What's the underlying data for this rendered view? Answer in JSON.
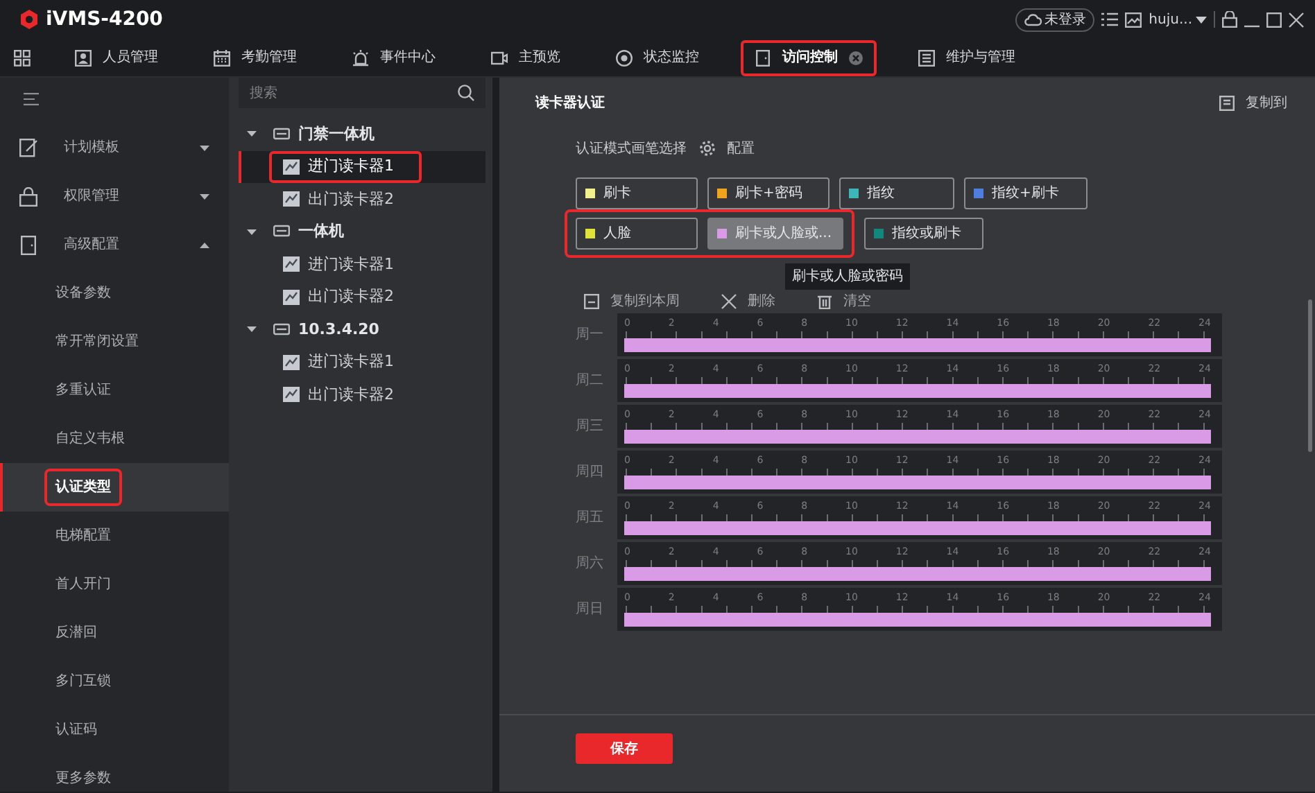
{
  "app": {
    "title": "iVMS-4200",
    "login_status": "未登录",
    "user": "huju..."
  },
  "nav_tabs": [
    {
      "label": "人员管理",
      "kind": "people",
      "selected": false,
      "highlighted": false
    },
    {
      "label": "考勤管理",
      "kind": "calendar",
      "selected": false,
      "highlighted": false
    },
    {
      "label": "事件中心",
      "kind": "alarm",
      "selected": false,
      "highlighted": false
    },
    {
      "label": "主预览",
      "kind": "camera",
      "selected": false,
      "highlighted": false
    },
    {
      "label": "状态监控",
      "kind": "monitor",
      "selected": false,
      "highlighted": false
    },
    {
      "label": "访问控制",
      "kind": "door",
      "selected": true,
      "highlighted": true
    },
    {
      "label": "维护与管理",
      "kind": "tools",
      "selected": false,
      "highlighted": false
    }
  ],
  "sidebar": {
    "items": [
      {
        "label": "计划模板",
        "kind": "edit",
        "expanded": false
      },
      {
        "label": "权限管理",
        "kind": "lock",
        "expanded": false
      },
      {
        "label": "高级配置",
        "kind": "door",
        "expanded": true,
        "children": [
          {
            "label": "设备参数",
            "selected": false,
            "highlighted": false
          },
          {
            "label": "常开常闭设置",
            "selected": false,
            "highlighted": false
          },
          {
            "label": "多重认证",
            "selected": false,
            "highlighted": false
          },
          {
            "label": "自定义韦根",
            "selected": false,
            "highlighted": false
          },
          {
            "label": "认证类型",
            "selected": true,
            "highlighted": true
          },
          {
            "label": "电梯配置",
            "selected": false,
            "highlighted": false
          },
          {
            "label": "首人开门",
            "selected": false,
            "highlighted": false
          },
          {
            "label": "反潜回",
            "selected": false,
            "highlighted": false
          },
          {
            "label": "多门互锁",
            "selected": false,
            "highlighted": false
          },
          {
            "label": "认证码",
            "selected": false,
            "highlighted": false
          },
          {
            "label": "更多参数",
            "selected": false,
            "highlighted": false
          }
        ]
      }
    ]
  },
  "tree": {
    "search": {
      "placeholder": "搜索"
    },
    "nodes": [
      {
        "label": "门禁一体机",
        "expanded": true,
        "children": [
          {
            "label": "进门读卡器1",
            "selected": true,
            "highlighted": true
          },
          {
            "label": "出门读卡器2",
            "selected": false,
            "highlighted": false
          }
        ]
      },
      {
        "label": "一体机",
        "expanded": true,
        "children": [
          {
            "label": "进门读卡器1",
            "selected": false,
            "highlighted": false
          },
          {
            "label": "出门读卡器2",
            "selected": false,
            "highlighted": false
          }
        ]
      },
      {
        "label": "10.3.4.20",
        "expanded": true,
        "children": [
          {
            "label": "进门读卡器1",
            "selected": false,
            "highlighted": false
          },
          {
            "label": "出门读卡器2",
            "selected": false,
            "highlighted": false
          }
        ]
      }
    ]
  },
  "main": {
    "title": "读卡器认证",
    "copy_to": "复制到",
    "brush_label": "认证模式画笔选择",
    "config": "配置",
    "mode_rows": [
      {
        "modes": [
          {
            "label": "刷卡",
            "color": "#f3ef8c",
            "selected": false,
            "highlighted": false
          },
          {
            "label": "刷卡+密码",
            "color": "#f0a41e",
            "selected": false,
            "highlighted": false
          },
          {
            "label": "指纹",
            "color": "#3cb6b8",
            "selected": false,
            "highlighted": false
          },
          {
            "label": "指纹+刷卡",
            "color": "#4d7fe0",
            "selected": false,
            "highlighted": false
          }
        ]
      },
      {
        "modes": [
          {
            "label": "人脸",
            "color": "#e0e23a",
            "selected": false,
            "highlighted": true
          },
          {
            "label": "刷卡或人脸或...",
            "color": "#d99ae6",
            "selected": true,
            "highlighted": true
          },
          {
            "label": "指纹或刷卡",
            "color": "#11877e",
            "selected": false,
            "highlighted": false
          }
        ]
      }
    ],
    "tooltip": "刷卡或人脸或密码",
    "toolbar": [
      {
        "label": "复制到本周",
        "kind": "copy"
      },
      {
        "label": "删除",
        "kind": "delete"
      },
      {
        "label": "清空",
        "kind": "clear"
      }
    ],
    "schedule": [
      {
        "day": "周一",
        "level": 1,
        "ticks": [
          "0",
          "2",
          "4",
          "6",
          "8",
          "10",
          "12",
          "14",
          "16",
          "18",
          "20",
          "22",
          "24"
        ]
      },
      {
        "day": "周二",
        "level": 1,
        "ticks": [
          "0",
          "2",
          "4",
          "6",
          "8",
          "10",
          "12",
          "14",
          "16",
          "18",
          "20",
          "22",
          "24"
        ]
      },
      {
        "day": "周三",
        "level": 1,
        "ticks": [
          "0",
          "2",
          "4",
          "6",
          "8",
          "10",
          "12",
          "14",
          "16",
          "18",
          "20",
          "22",
          "24"
        ]
      },
      {
        "day": "周四",
        "level": 1,
        "ticks": [
          "0",
          "2",
          "4",
          "6",
          "8",
          "10",
          "12",
          "14",
          "16",
          "18",
          "20",
          "22",
          "24"
        ]
      },
      {
        "day": "周五",
        "level": 1,
        "ticks": [
          "0",
          "2",
          "4",
          "6",
          "8",
          "10",
          "12",
          "14",
          "16",
          "18",
          "20",
          "22",
          "24"
        ]
      },
      {
        "day": "周六",
        "level": 1,
        "ticks": [
          "0",
          "2",
          "4",
          "6",
          "8",
          "10",
          "12",
          "14",
          "16",
          "18",
          "20",
          "22",
          "24"
        ]
      },
      {
        "day": "周日",
        "level": 1,
        "ticks": [
          "0",
          "2",
          "4",
          "6",
          "8",
          "10",
          "12",
          "14",
          "16",
          "18",
          "20",
          "22",
          "24"
        ]
      }
    ],
    "save": "保存"
  }
}
